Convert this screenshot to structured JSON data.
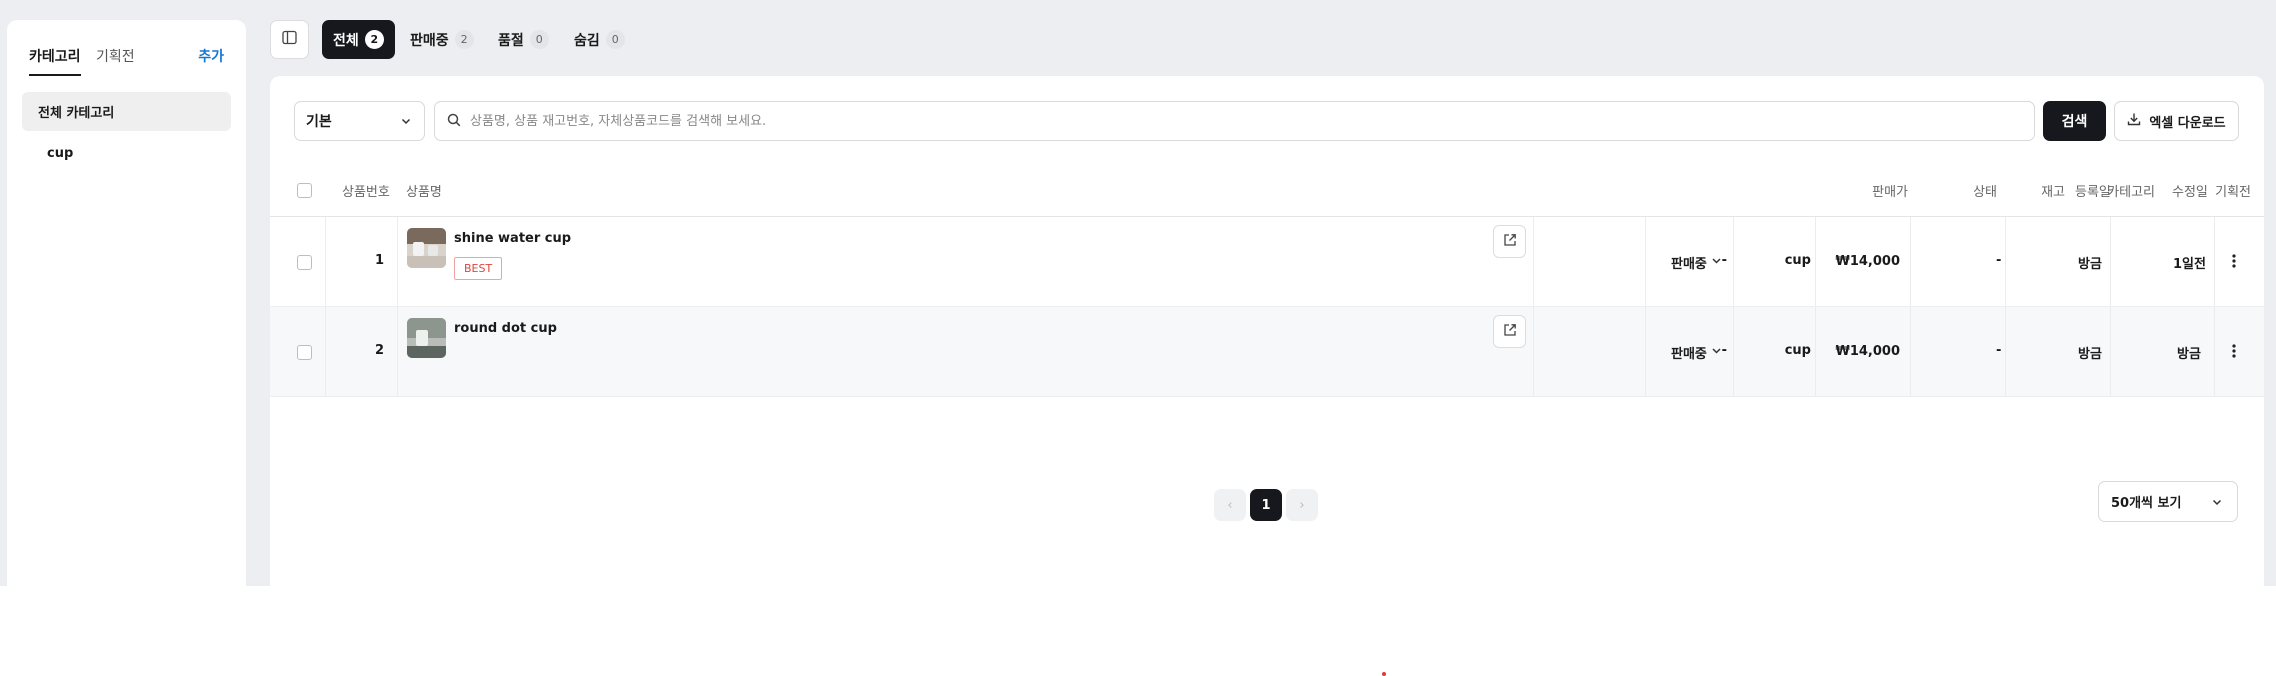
{
  "sidebar": {
    "tabs": [
      {
        "label": "카테고리"
      },
      {
        "label": "기획전"
      }
    ],
    "add_label": "추가",
    "items": [
      {
        "label": "전체 카테고리"
      },
      {
        "label": "cup"
      }
    ]
  },
  "status_tabs": [
    {
      "label": "전체",
      "count": "2"
    },
    {
      "label": "판매중",
      "count": "2"
    },
    {
      "label": "품절",
      "count": "0"
    },
    {
      "label": "숨김",
      "count": "0"
    }
  ],
  "toolbar": {
    "filter_select": "기본",
    "search_placeholder": "상품명, 상품 재고번호, 자체상품코드를 검색해 보세요.",
    "search_button": "검색",
    "excel_button": "엑셀 다운로드"
  },
  "table": {
    "headers": {
      "no": "상품번호",
      "name": "상품명",
      "price": "판매가",
      "status": "상태",
      "stock": "재고",
      "category": "카테고리",
      "exhibition": "기획전",
      "registered": "등록일",
      "modified": "수정일"
    },
    "rows": [
      {
        "no": "1",
        "name": "shine water cup",
        "badge": "BEST",
        "price": "₩14,000",
        "status": "판매중",
        "stock": "-",
        "category": "cup",
        "exhibition": "-",
        "registered": "방금",
        "modified": "1일전"
      },
      {
        "no": "2",
        "name": "round dot cup",
        "badge": "",
        "price": "₩14,000",
        "status": "판매중",
        "stock": "-",
        "category": "cup",
        "exhibition": "-",
        "registered": "방금",
        "modified": "방금"
      }
    ]
  },
  "pagination": {
    "prev": "‹",
    "current": "1",
    "next": "›",
    "page_size": "50개씩 보기"
  },
  "colors": {
    "accent_dark": "#16181d",
    "link_blue": "#1677d2",
    "badge_red": "#e0443e"
  }
}
